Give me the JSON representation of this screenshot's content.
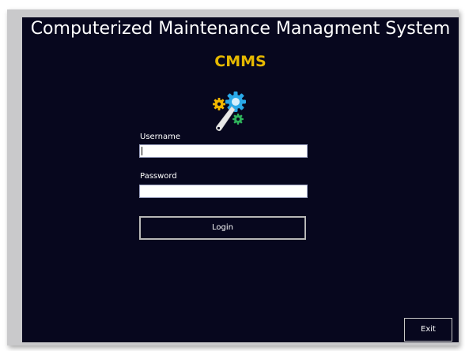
{
  "app": {
    "title": "Computerized Maintenance Managment System",
    "acronym": "CMMS",
    "logo_icon": "wrench-gears-icon"
  },
  "form": {
    "username_label": "Username",
    "username_value": "",
    "password_label": "Password",
    "password_value": "",
    "login_label": "Login"
  },
  "footer": {
    "exit_label": "Exit"
  },
  "colors": {
    "background": "#07071e",
    "accent": "#e5b800",
    "gear_blue": "#29a8e8",
    "gear_yellow": "#f2b800",
    "gear_green": "#2fb35b"
  }
}
